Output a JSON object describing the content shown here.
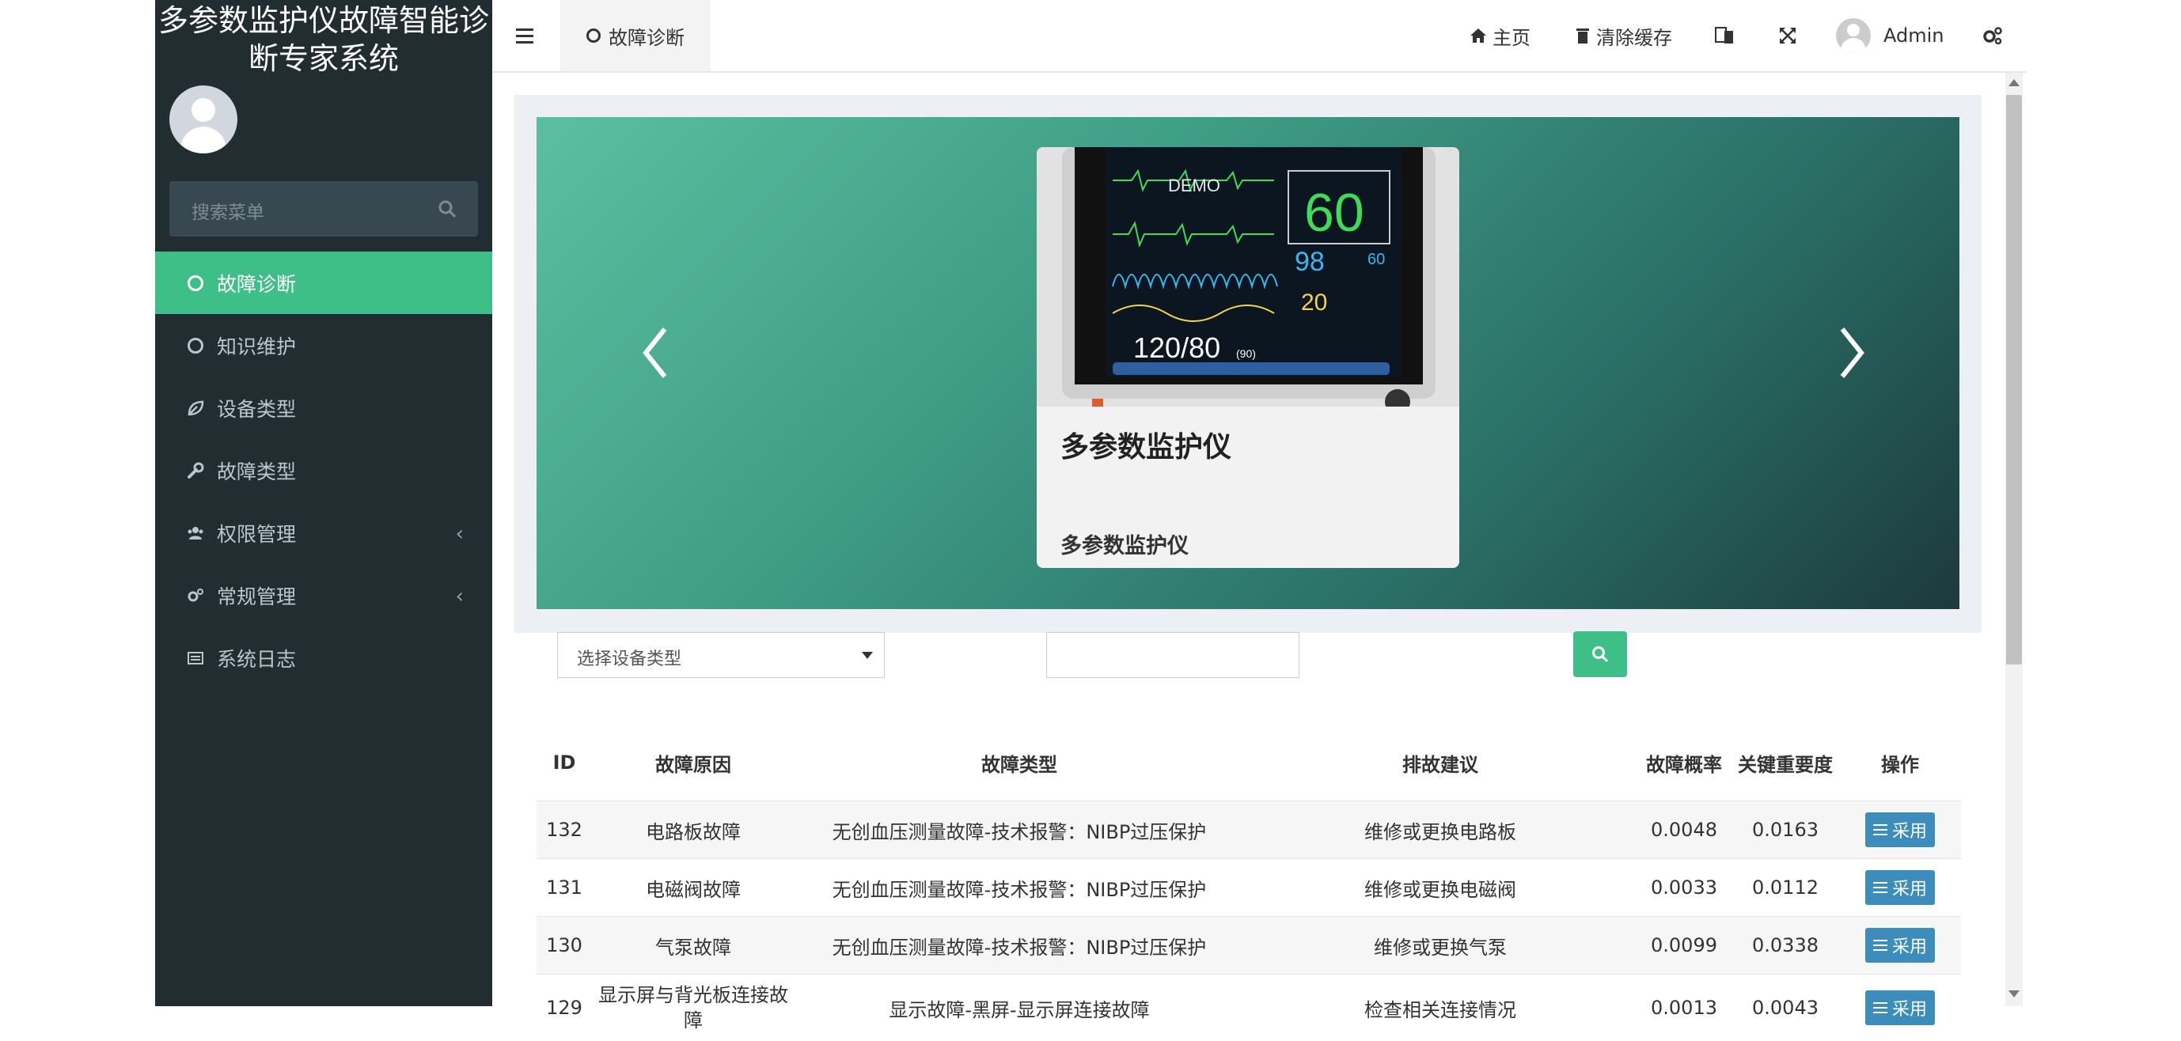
{
  "app": {
    "title": "多参数监护仪故障智能诊断专家系统"
  },
  "sidebar": {
    "search_placeholder": "搜索菜单",
    "items": [
      {
        "label": "故障诊断",
        "icon": "circle-icon",
        "active": true
      },
      {
        "label": "知识维护",
        "icon": "circle-icon"
      },
      {
        "label": "设备类型",
        "icon": "leaf-icon"
      },
      {
        "label": "故障类型",
        "icon": "wrench-icon"
      },
      {
        "label": "权限管理",
        "icon": "users-icon",
        "has_submenu": true
      },
      {
        "label": "常规管理",
        "icon": "cogs-icon",
        "has_submenu": true
      },
      {
        "label": "系统日志",
        "icon": "list-icon"
      }
    ],
    "chevron": "‹"
  },
  "header": {
    "tab_label": "故障诊断",
    "home_label": "主页",
    "clear_cache_label": "清除缓存",
    "user_name": "Admin"
  },
  "carousel": {
    "card_title": "多参数监护仪",
    "card_subtitle": "多参数监护仪",
    "monitor": {
      "brand": "DEMO",
      "hr": "60",
      "spo2": "98",
      "pulse": "60",
      "resp": "20",
      "bp": "120/80",
      "map": "(90)"
    }
  },
  "filters": {
    "device_select": "选择设备类型",
    "keyword": ""
  },
  "table": {
    "columns": [
      "ID",
      "故障原因",
      "故障类型",
      "排故建议",
      "故障概率",
      "关键重要度",
      "操作"
    ],
    "action_label": "采用",
    "rows": [
      {
        "id": "132",
        "reason": "电路板故障",
        "type": "无创血压测量故障-技术报警：NIBP过压保护",
        "advice": "维修或更换电路板",
        "prob": "0.0048",
        "imp": "0.0163"
      },
      {
        "id": "131",
        "reason": "电磁阀故障",
        "type": "无创血压测量故障-技术报警：NIBP过压保护",
        "advice": "维修或更换电磁阀",
        "prob": "0.0033",
        "imp": "0.0112"
      },
      {
        "id": "130",
        "reason": "气泵故障",
        "type": "无创血压测量故障-技术报警：NIBP过压保护",
        "advice": "维修或更换气泵",
        "prob": "0.0099",
        "imp": "0.0338"
      },
      {
        "id": "129",
        "reason": "显示屏与背光板连接故障",
        "type": "显示故障-黑屏-显示屏连接故障",
        "advice": "检查相关连接情况",
        "prob": "0.0013",
        "imp": "0.0043"
      }
    ]
  },
  "colors": {
    "sidebar": "#222d32",
    "accent": "#3fbf88",
    "button_blue": "#3c8dbc"
  }
}
